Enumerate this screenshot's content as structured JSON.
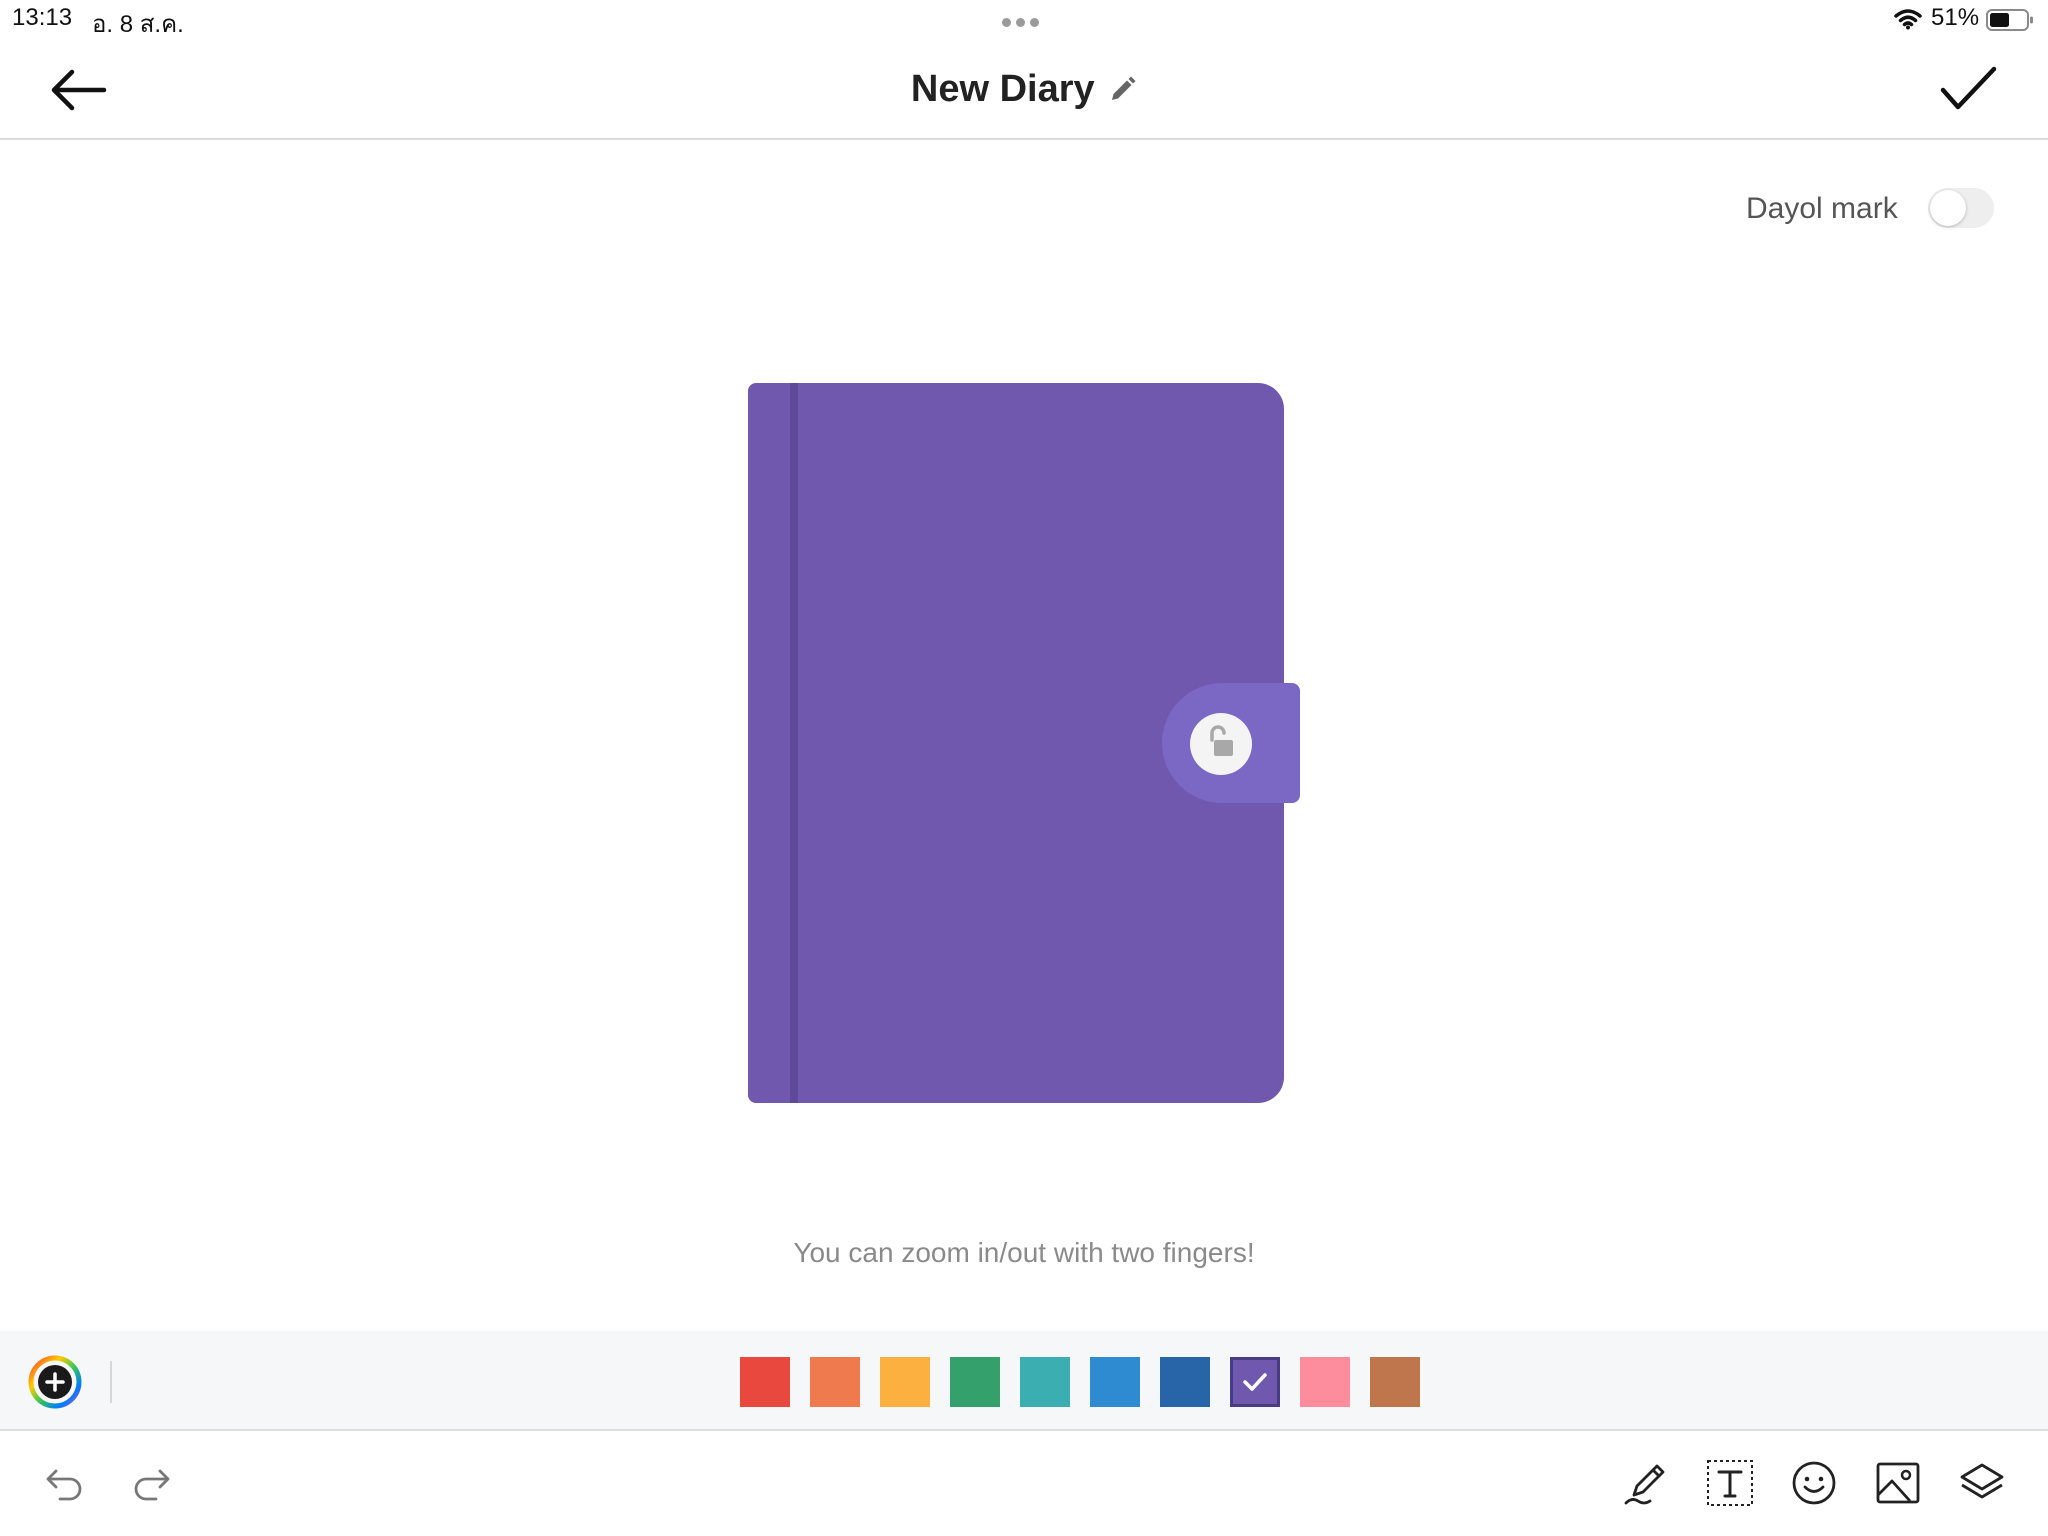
{
  "status_bar": {
    "time": "13:13",
    "date": "อ. 8 ส.ค.",
    "battery": "51%",
    "icons": [
      "more-dots-icon",
      "wifi-icon",
      "battery-icon"
    ]
  },
  "header": {
    "title": "New Diary",
    "icons": [
      "back-arrow-icon",
      "pencil-icon",
      "checkmark-icon"
    ]
  },
  "dayol_mark": {
    "label": "Dayol mark",
    "enabled": false
  },
  "diary": {
    "cover_color": "#6f58ad",
    "clasp_color": "#7b68c5",
    "lock_state": "unlocked",
    "icons": [
      "unlock-icon"
    ]
  },
  "hint": "You can zoom in/out with two fingers!",
  "palette": {
    "selected_index": 7,
    "colors": [
      "#e8483e",
      "#ef7a4e",
      "#fbb040",
      "#34a06b",
      "#3aaeb0",
      "#2f8bd1",
      "#2865a8",
      "#6f58ad",
      "#fd8c9c",
      "#c0764c"
    ],
    "icons": [
      "color-wheel-add-icon",
      "checkmark-icon"
    ]
  },
  "toolbar": {
    "icons": [
      "undo-icon",
      "redo-icon",
      "pen-icon",
      "text-box-icon",
      "sticker-smile-icon",
      "image-icon",
      "layers-icon"
    ]
  }
}
